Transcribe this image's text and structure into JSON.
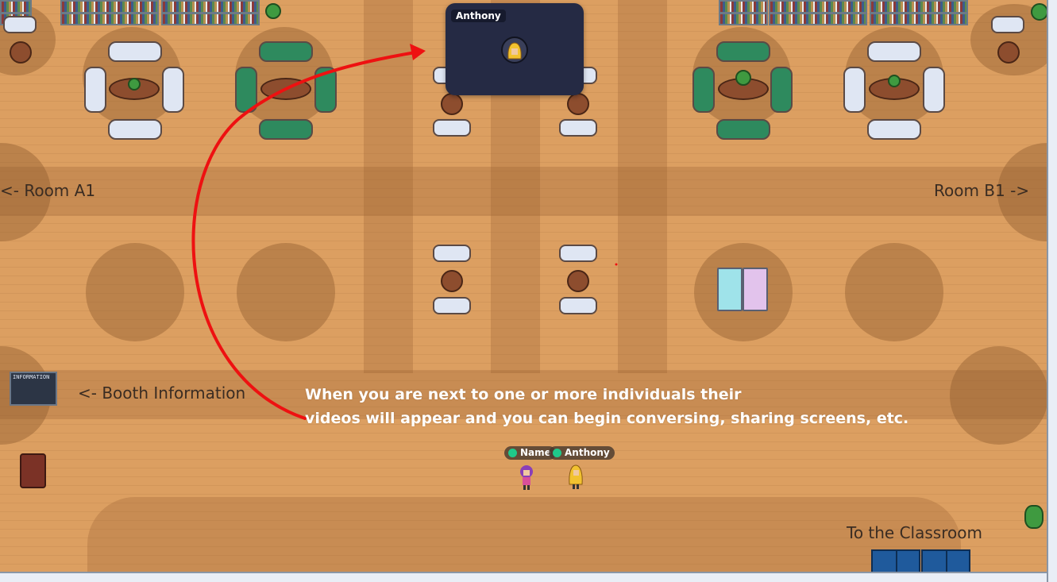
{
  "room_labels": {
    "room_a1": "<- Room A1",
    "room_b1": "Room B1 ->",
    "booth_information": "<- Booth Information",
    "to_classroom": "To the Classroom"
  },
  "info_board": {
    "text": "INFORMATION"
  },
  "video_panel": {
    "participant_name": "Anthony"
  },
  "players": [
    {
      "name": "Name",
      "status": "online"
    },
    {
      "name": "Anthony",
      "status": "online"
    }
  ],
  "caption": {
    "line1": "When you are next to one or more individuals their",
    "line2": "videos will appear and you can begin conversing, sharing screens, etc."
  },
  "colors": {
    "floor": "#dc9f61",
    "arrow": "#ee1111",
    "video_panel": "#252a44",
    "status_online": "#1fc98a"
  }
}
